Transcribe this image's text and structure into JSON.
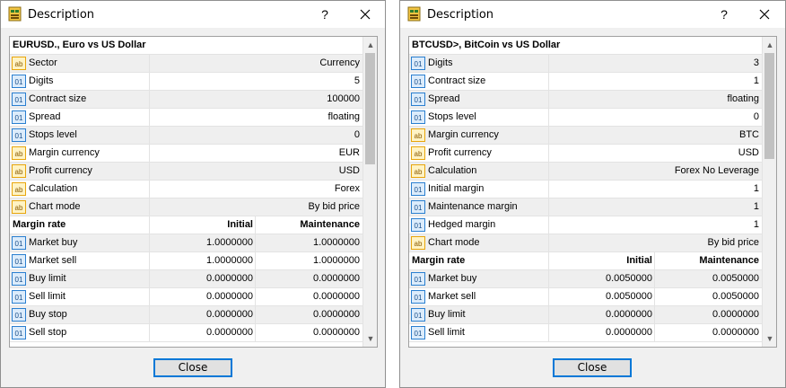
{
  "left": {
    "title": "Description",
    "help": "?",
    "header": "EURUSD., Euro vs US Dollar",
    "props": [
      {
        "icon": "ab",
        "label": "Sector",
        "value": "Currency"
      },
      {
        "icon": "01",
        "label": "Digits",
        "value": "5"
      },
      {
        "icon": "01",
        "label": "Contract size",
        "value": "100000"
      },
      {
        "icon": "01",
        "label": "Spread",
        "value": "floating"
      },
      {
        "icon": "01",
        "label": "Stops level",
        "value": "0"
      },
      {
        "icon": "ab",
        "label": "Margin currency",
        "value": "EUR"
      },
      {
        "icon": "ab",
        "label": "Profit currency",
        "value": "USD"
      },
      {
        "icon": "ab",
        "label": "Calculation",
        "value": "Forex"
      },
      {
        "icon": "ab",
        "label": "Chart mode",
        "value": "By bid price"
      }
    ],
    "rate_header": {
      "label": "Margin rate",
      "initial": "Initial",
      "maintenance": "Maintenance"
    },
    "rates": [
      {
        "label": "Market buy",
        "initial": "1.0000000",
        "maintenance": "1.0000000"
      },
      {
        "label": "Market sell",
        "initial": "1.0000000",
        "maintenance": "1.0000000"
      },
      {
        "label": "Buy limit",
        "initial": "0.0000000",
        "maintenance": "0.0000000"
      },
      {
        "label": "Sell limit",
        "initial": "0.0000000",
        "maintenance": "0.0000000"
      },
      {
        "label": "Buy stop",
        "initial": "0.0000000",
        "maintenance": "0.0000000"
      },
      {
        "label": "Sell stop",
        "initial": "0.0000000",
        "maintenance": "0.0000000"
      }
    ],
    "close_label": "Close"
  },
  "right": {
    "title": "Description",
    "help": "?",
    "header": "BTCUSD>, BitCoin vs US Dollar",
    "props": [
      {
        "icon": "01",
        "label": "Digits",
        "value": "3"
      },
      {
        "icon": "01",
        "label": "Contract size",
        "value": "1"
      },
      {
        "icon": "01",
        "label": "Spread",
        "value": "floating"
      },
      {
        "icon": "01",
        "label": "Stops level",
        "value": "0"
      },
      {
        "icon": "ab",
        "label": "Margin currency",
        "value": "BTC"
      },
      {
        "icon": "ab",
        "label": "Profit currency",
        "value": "USD"
      },
      {
        "icon": "ab",
        "label": "Calculation",
        "value": "Forex No Leverage"
      },
      {
        "icon": "01",
        "label": "Initial margin",
        "value": "1"
      },
      {
        "icon": "01",
        "label": "Maintenance margin",
        "value": "1"
      },
      {
        "icon": "01",
        "label": "Hedged margin",
        "value": "1"
      },
      {
        "icon": "ab",
        "label": "Chart mode",
        "value": "By bid price"
      }
    ],
    "rate_header": {
      "label": "Margin rate",
      "initial": "Initial",
      "maintenance": "Maintenance"
    },
    "rates": [
      {
        "label": "Market buy",
        "initial": "0.0050000",
        "maintenance": "0.0050000"
      },
      {
        "label": "Market sell",
        "initial": "0.0050000",
        "maintenance": "0.0050000"
      },
      {
        "label": "Buy limit",
        "initial": "0.0000000",
        "maintenance": "0.0000000"
      },
      {
        "label": "Sell limit",
        "initial": "0.0000000",
        "maintenance": "0.0000000"
      }
    ],
    "close_label": "Close"
  },
  "colors": {
    "ab_icon": "#e8a60c",
    "num_icon": "#2a7fd0",
    "focus_border": "#0078d7"
  }
}
